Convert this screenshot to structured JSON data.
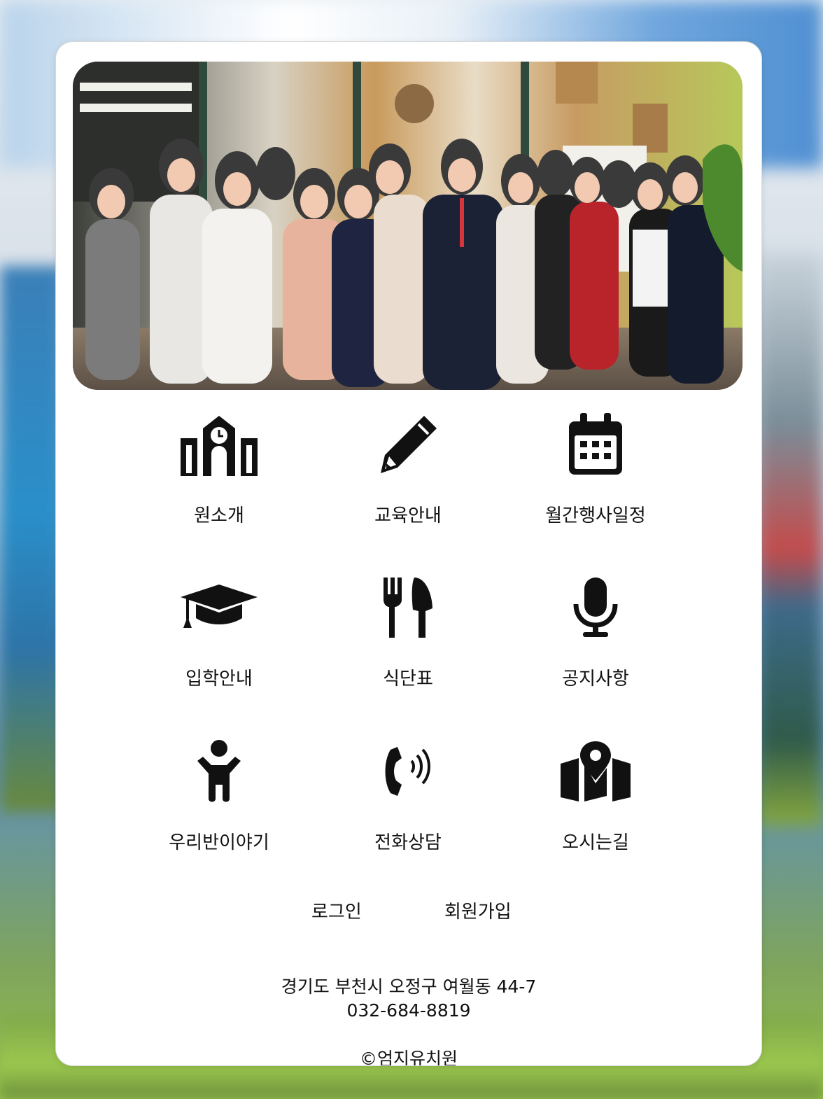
{
  "menu": [
    {
      "label": "원소개",
      "icon": "school-icon"
    },
    {
      "label": "교육안내",
      "icon": "pencil-icon"
    },
    {
      "label": "월간행사일정",
      "icon": "calendar-icon"
    },
    {
      "label": "입학안내",
      "icon": "graduation-cap-icon"
    },
    {
      "label": "식단표",
      "icon": "utensils-icon"
    },
    {
      "label": "공지사항",
      "icon": "microphone-icon"
    },
    {
      "label": "우리반이야기",
      "icon": "child-icon"
    },
    {
      "label": "전화상담",
      "icon": "phone-volume-icon"
    },
    {
      "label": "오시는길",
      "icon": "map-location-icon"
    }
  ],
  "auth": {
    "login": "로그인",
    "signup": "회원가입"
  },
  "footer": {
    "address": "경기도 부천시 오정구 여월동 44-7",
    "phone": "032-684-8819",
    "copyright": "©엄지유치원"
  },
  "colors": {
    "icon": "#111111",
    "card": "#ffffff"
  }
}
